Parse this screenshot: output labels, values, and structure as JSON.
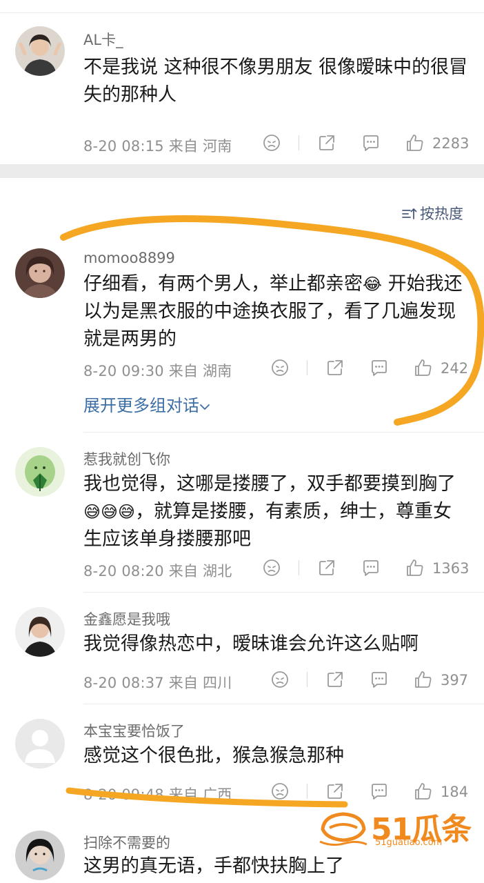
{
  "sort_label": "按热度",
  "expand_label": "展开更多组对话",
  "colors": {
    "accent_link": "#3b6ea5",
    "annotation": "#f5a623",
    "watermark": "#f08a1e"
  },
  "watermark": {
    "brand": "51瓜条",
    "site": "51guatiao.com"
  },
  "comments": [
    {
      "username": "AL卡_",
      "text": "不是我说 这种很不像男朋友 很像暧昧中的很冒失的那种人",
      "time": "8-20 08:15",
      "location": "来自 河南",
      "likes": "2283"
    },
    {
      "username": "momoo8899",
      "text_a": "仔细看，有两个男人，举止都亲密",
      "emoji": "😂",
      "text_b": " 开始我还以为是黑衣服的中途换衣服了，看了几遍发现就是两男的",
      "time": "8-20 09:30",
      "location": "来自 湖南",
      "likes": "242"
    },
    {
      "username": "惹我就创飞你",
      "text_a": "我也觉得，这哪是搂腰了，双手都要摸到胸了",
      "emoji": "😅😅😅",
      "text_b": "，就算是搂腰，有素质，绅士，尊重女生应该单身搂腰那吧",
      "time": "8-20 08:20",
      "location": "来自 湖北",
      "likes": "1363"
    },
    {
      "username": "金鑫愿是我哦",
      "text": "我觉得像热恋中，暧昧谁会允许这么贴啊",
      "time": "8-20 08:37",
      "location": "来自 四川",
      "likes": "397"
    },
    {
      "username": "本宝宝要恰饭了",
      "text": "感觉这个很色批，猴急猴急那种",
      "time": "8-20 09:48",
      "location": "来自 广西",
      "likes": "184"
    },
    {
      "username": "扫除不需要的",
      "text": "这男的真无语，手都快扶胸上了"
    }
  ]
}
